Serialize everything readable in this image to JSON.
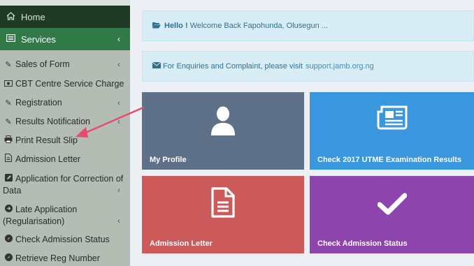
{
  "sidebar": {
    "home": {
      "label": "Home",
      "icon": "home-icon"
    },
    "services": {
      "label": "Services",
      "icon": "list-alt-icon"
    },
    "items": [
      {
        "label": "Sales of Form",
        "icon": "edit-icon",
        "chevron": true
      },
      {
        "label": "CBT Centre Service Charge",
        "icon": "money-icon",
        "chevron": false
      },
      {
        "label": "Registration",
        "icon": "edit-icon",
        "chevron": true
      },
      {
        "label": "Results Notification",
        "icon": "edit-icon",
        "chevron": true
      },
      {
        "label": "Print Result Slip",
        "icon": "print-icon",
        "chevron": false
      },
      {
        "label": "Admission Letter",
        "icon": "file-text-icon",
        "chevron": false
      },
      {
        "label_line1": "Application for Correction of",
        "label_line2": "Data",
        "icon": "edit-square-icon",
        "chevron": true
      },
      {
        "label_line1": "Late Application",
        "label_line2": "(Regularisation)",
        "icon": "arrow-circle-icon",
        "chevron": true
      },
      {
        "label": "Check Admission Status",
        "icon": "compass-icon",
        "chevron": false
      },
      {
        "label": "Retrieve Reg Number",
        "icon": "compass-icon",
        "chevron": false
      }
    ]
  },
  "alerts": {
    "welcome": {
      "greeting": "Hello !",
      "message": "Welcome Back Fapohunda, Olusegun ...",
      "icon": "folder-open-icon"
    },
    "enquiry": {
      "message": "For Enquiries and Complaint, please visit",
      "link": "support.jamb.org.ng",
      "icon": "envelope-icon"
    }
  },
  "tiles": [
    {
      "label": "My Profile",
      "icon": "user-icon",
      "color": "#5f7189"
    },
    {
      "label": "Check 2017 UTME Examination Results",
      "icon": "newspaper-icon",
      "color": "#3a97de"
    },
    {
      "label": "Admission Letter",
      "icon": "file-text-icon",
      "color": "#cc5a5a"
    },
    {
      "label": "Check Admission Status",
      "icon": "check-icon",
      "color": "#8e44ad"
    }
  ],
  "colors": {
    "annotation_arrow": "#e8496e",
    "sidebar_active": "#2f7a47",
    "sidebar_dark": "#1f3a25"
  }
}
